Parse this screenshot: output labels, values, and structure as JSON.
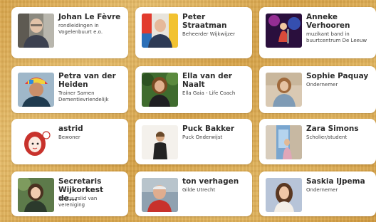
{
  "people": [
    {
      "name": "Johan Le Fèvre",
      "description": "rondleidingen in Vogelenbuurt e.o."
    },
    {
      "name": "Peter Straatman",
      "description": "Beheerder Wijkwijzer"
    },
    {
      "name": "Anneke Verhooren",
      "description": "muzikant band in buurtcentrum De Leeuw"
    },
    {
      "name": "Petra van der Heiden",
      "description": "Trainer Samen Dementievriendelijk"
    },
    {
      "name": "Ella van der Naalt",
      "description": "Ella Gaia - Life Coach"
    },
    {
      "name": "Sophie Paquay",
      "description": "Ondernemer"
    },
    {
      "name": "astrid",
      "description": "Bewoner"
    },
    {
      "name": "Puck Bakker",
      "description": "Puck Onderwijst"
    },
    {
      "name": "Zara Simons",
      "description": "Scholier/student"
    },
    {
      "name": "Secretaris Wijkorkest de...",
      "description": "Bestuurslid van vereniging"
    },
    {
      "name": "ton verhagen",
      "description": "Gilde Utrecht"
    },
    {
      "name": "Saskia IJpema",
      "description": "Ondernemer"
    }
  ]
}
